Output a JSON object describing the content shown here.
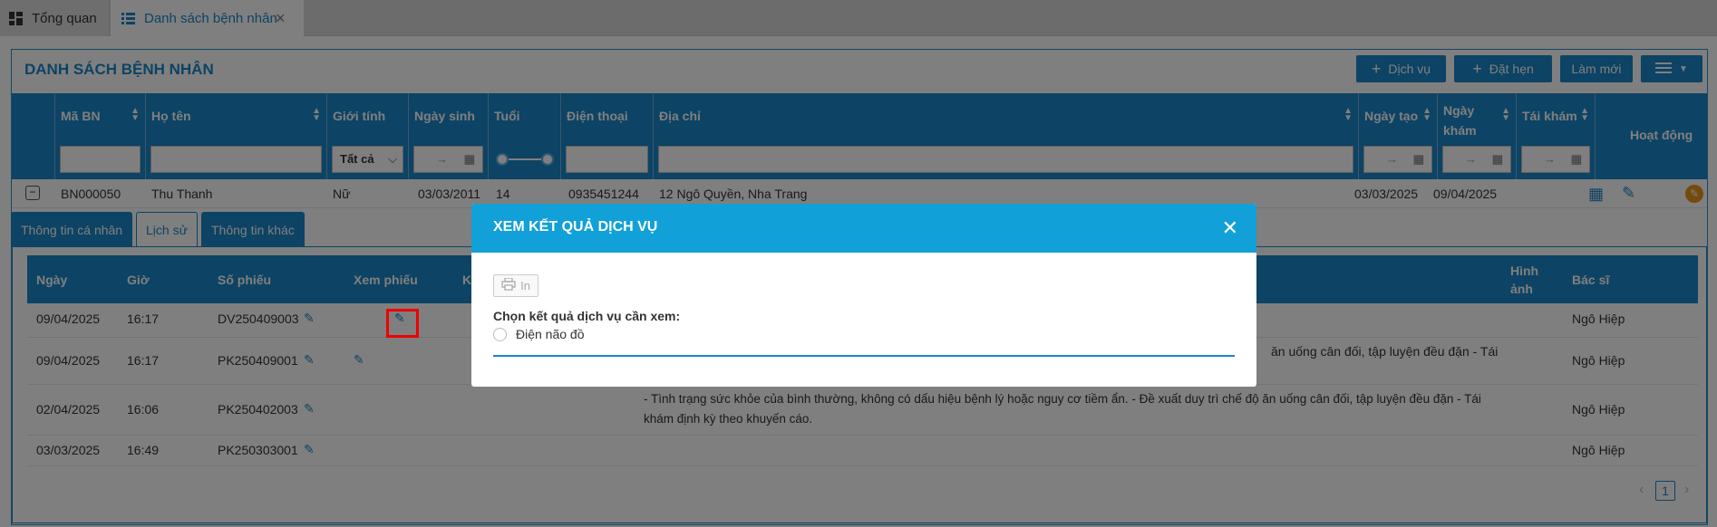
{
  "tabs": [
    {
      "label": "Tổng quan"
    },
    {
      "label": "Danh sách bệnh nhân"
    }
  ],
  "panel_title": "DANH SÁCH BỆNH NHÂN",
  "toolbar": {
    "service_label": "Dịch vụ",
    "appointment_label": "Đặt hẹn",
    "refresh_label": "Làm mới"
  },
  "grid": {
    "columns": [
      "Mã BN",
      "Họ tên",
      "Giới tính",
      "Ngày sinh",
      "Tuổi",
      "Điện thoại",
      "Địa chỉ",
      "Ngày tạo",
      "Ngày khám",
      "Tái khám",
      "Hoạt động"
    ],
    "gender_filter": "Tất cả",
    "range_arrow": "→",
    "row": {
      "id": "BN000050",
      "name": "Thu Thanh",
      "gender": "Nữ",
      "dob": "03/03/2011",
      "age": "14",
      "phone": "0935451244",
      "address": "12 Ngô Quyền, Nha Trang",
      "created": "03/03/2025",
      "visit": "09/04/2025"
    }
  },
  "subtabs": [
    "Thông tin cá nhân",
    "Lịch sử",
    "Thông tin khác"
  ],
  "history": {
    "columns": [
      "Ngày",
      "Giờ",
      "Số phiếu",
      "Xem phiếu",
      "K",
      "Hình ảnh",
      "Bác sĩ"
    ],
    "rows": [
      {
        "date": "09/04/2025",
        "time": "16:17",
        "ticket": "DV250409003",
        "note": "",
        "doctor": "Ngô Hiệp"
      },
      {
        "date": "09/04/2025",
        "time": "16:17",
        "ticket": "PK250409001",
        "note": "ăn uống cân đối, tập luyện đều đặn - Tái",
        "doctor": "Ngô Hiệp"
      },
      {
        "date": "02/04/2025",
        "time": "16:06",
        "ticket": "PK250402003",
        "note": "- Tình trạng sức khỏe của bình thường, không có dấu hiệu bệnh lý hoặc nguy cơ tiềm ẩn. - Đề xuất duy trì chế độ ăn uống cân đối, tập luyện đều đặn - Tái",
        "note2": "khám định kỳ theo khuyến cáo.",
        "doctor": "Ngô Hiệp"
      },
      {
        "date": "03/03/2025",
        "time": "16:49",
        "ticket": "PK250303001",
        "note": "",
        "doctor": "Ngô Hiệp"
      }
    ],
    "page": "1"
  },
  "modal": {
    "title": "XEM KẾT QUẢ DỊCH VỤ",
    "print_label": "In",
    "prompt": "Chọn kết quả dịch vụ cần xem:",
    "option": "Điện não đồ"
  },
  "colors": {
    "primary": "#1a86c8",
    "modal_header": "#12a0d8",
    "highlight": "#ee0000"
  }
}
